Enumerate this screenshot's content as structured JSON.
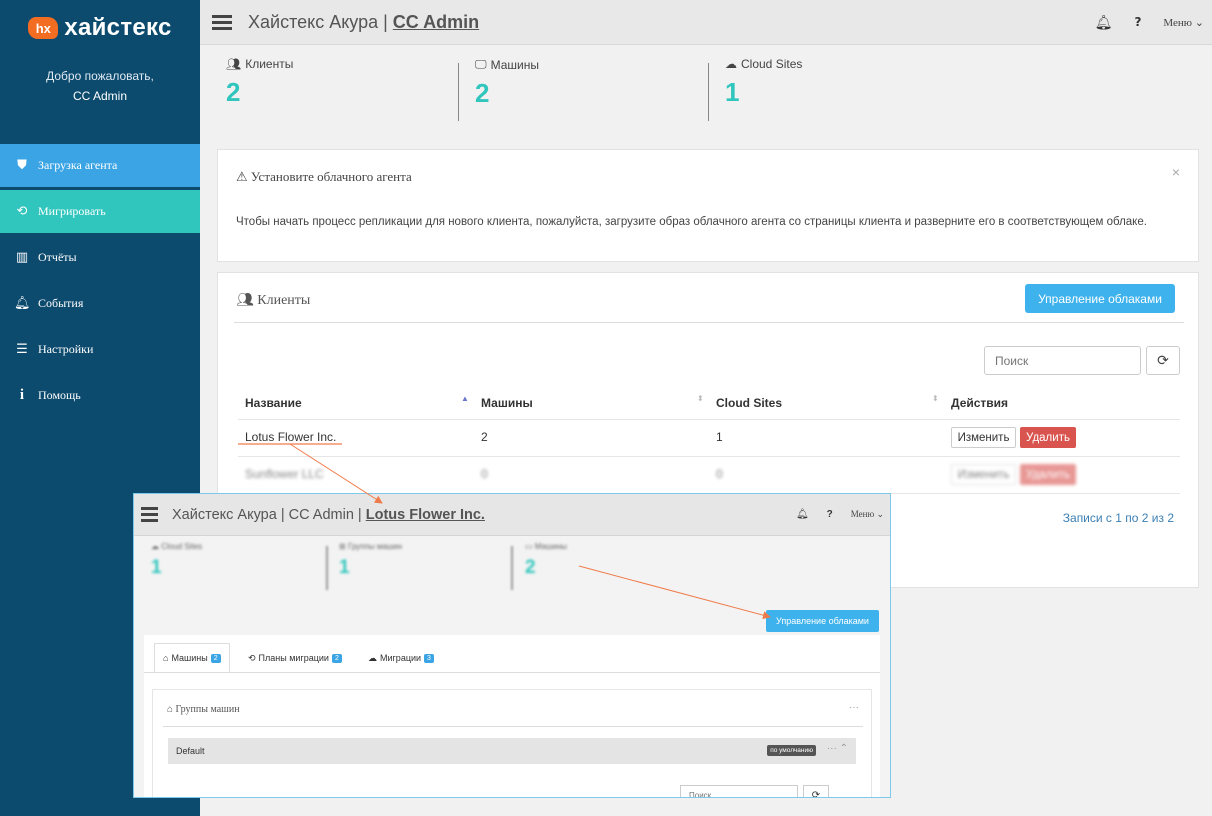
{
  "brand": {
    "badge": "hx",
    "name": "хайстекс"
  },
  "welcome": {
    "greeting": "Добро пожаловать,",
    "user": "CC Admin"
  },
  "nav": [
    {
      "label": "Загрузка агента",
      "icon": "shield-icon"
    },
    {
      "label": "Мигрировать",
      "icon": "migrate-icon"
    },
    {
      "label": "Отчёты",
      "icon": "bar-chart-icon"
    },
    {
      "label": "События",
      "icon": "bell-icon"
    },
    {
      "label": "Настройки",
      "icon": "sliders-icon"
    },
    {
      "label": "Помощь",
      "icon": "info-icon"
    }
  ],
  "header": {
    "title": "Хайстекс Акура | ",
    "subtitle": "CC Admin",
    "help": "?",
    "menu": "Меню"
  },
  "stats": [
    {
      "label": "Клиенты",
      "value": "2"
    },
    {
      "label": "Машины",
      "value": "2"
    },
    {
      "label": "Cloud Sites",
      "value": "1"
    }
  ],
  "alert": {
    "title": "Установите облачного агента",
    "close": "×",
    "text": "Чтобы начать процесс репликации для нового клиента, пожалуйста, загрузите образ облачного агента со страницы клиента и разверните его в соответствующем облаке."
  },
  "clients": {
    "title": "Клиенты",
    "manage_label": "Управление облаками",
    "search_placeholder": "Поиск",
    "columns": [
      "Название",
      "Машины",
      "Cloud Sites",
      "Действия"
    ],
    "rows": [
      {
        "name": "Lotus Flower Inc.",
        "machines": "2",
        "sites": "1",
        "edit": "Изменить",
        "delete": "Удалить"
      },
      {
        "name": "Sunflower LLC",
        "machines": "0",
        "sites": "0",
        "edit": "Изменить",
        "delete": "Удалить"
      }
    ],
    "records": "Записи с 1 по 2 из 2"
  },
  "inset": {
    "title": "Хайстекс Акура | CC Admin | ",
    "subtitle": "Lotus Flower Inc.",
    "help": "?",
    "menu": "Меню",
    "stats": [
      {
        "label": "Cloud Sites",
        "value": "1"
      },
      {
        "label": "Группы машин",
        "value": "1"
      },
      {
        "label": "Машины",
        "value": "2"
      }
    ],
    "manage_label": "Управление облаками",
    "tabs": [
      {
        "label": "Машины",
        "count": "2"
      },
      {
        "label": "Планы миграции",
        "count": "2"
      },
      {
        "label": "Миграции",
        "count": "3"
      }
    ],
    "groups_title": "Группы машин",
    "group_name": "Default",
    "group_tag": "по умолчанию",
    "search_placeholder": "Поиск"
  },
  "colors": {
    "sidebar": "#0c4a6e",
    "accent_blue": "#3aa4e4",
    "accent_teal": "#31c6bd",
    "danger": "#d9534f",
    "brand_orange": "#f26c21"
  }
}
